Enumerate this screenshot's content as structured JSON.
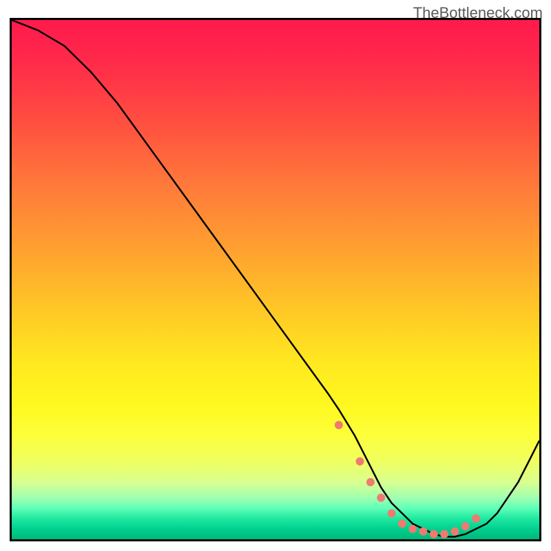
{
  "watermark": "TheBottleneck.com",
  "chart_data": {
    "type": "line",
    "title": "",
    "xlabel": "",
    "ylabel": "",
    "xlim": [
      0,
      100
    ],
    "ylim": [
      0,
      100
    ],
    "series": [
      {
        "name": "bottleneck-curve",
        "x": [
          0,
          5,
          10,
          15,
          20,
          25,
          30,
          35,
          40,
          45,
          50,
          55,
          60,
          62,
          65,
          68,
          70,
          72,
          74,
          76,
          78,
          80,
          82,
          84,
          86,
          88,
          90,
          92,
          94,
          96,
          98,
          100
        ],
        "values": [
          100,
          98,
          95,
          90,
          84,
          77,
          70,
          63,
          56,
          49,
          42,
          35,
          28,
          25,
          20,
          14,
          10,
          7,
          5,
          3,
          2,
          1,
          0.5,
          0.5,
          1,
          2,
          3,
          5,
          8,
          11,
          15,
          19
        ]
      }
    ],
    "markers": {
      "name": "highlight-points",
      "x": [
        62,
        66,
        68,
        70,
        72,
        74,
        76,
        78,
        80,
        82,
        84,
        86,
        88
      ],
      "values": [
        22,
        15,
        11,
        8,
        5,
        3,
        2,
        1.5,
        1,
        1,
        1.5,
        2.5,
        4
      ]
    },
    "marker_color": "#ed7b6f",
    "line_color": "#000000",
    "gradient_stops": [
      {
        "pos": 0,
        "color": "#ff1a4d"
      },
      {
        "pos": 50,
        "color": "#ffc826"
      },
      {
        "pos": 80,
        "color": "#fdff3a"
      },
      {
        "pos": 95,
        "color": "#20e8a0"
      },
      {
        "pos": 100,
        "color": "#00b878"
      }
    ]
  }
}
